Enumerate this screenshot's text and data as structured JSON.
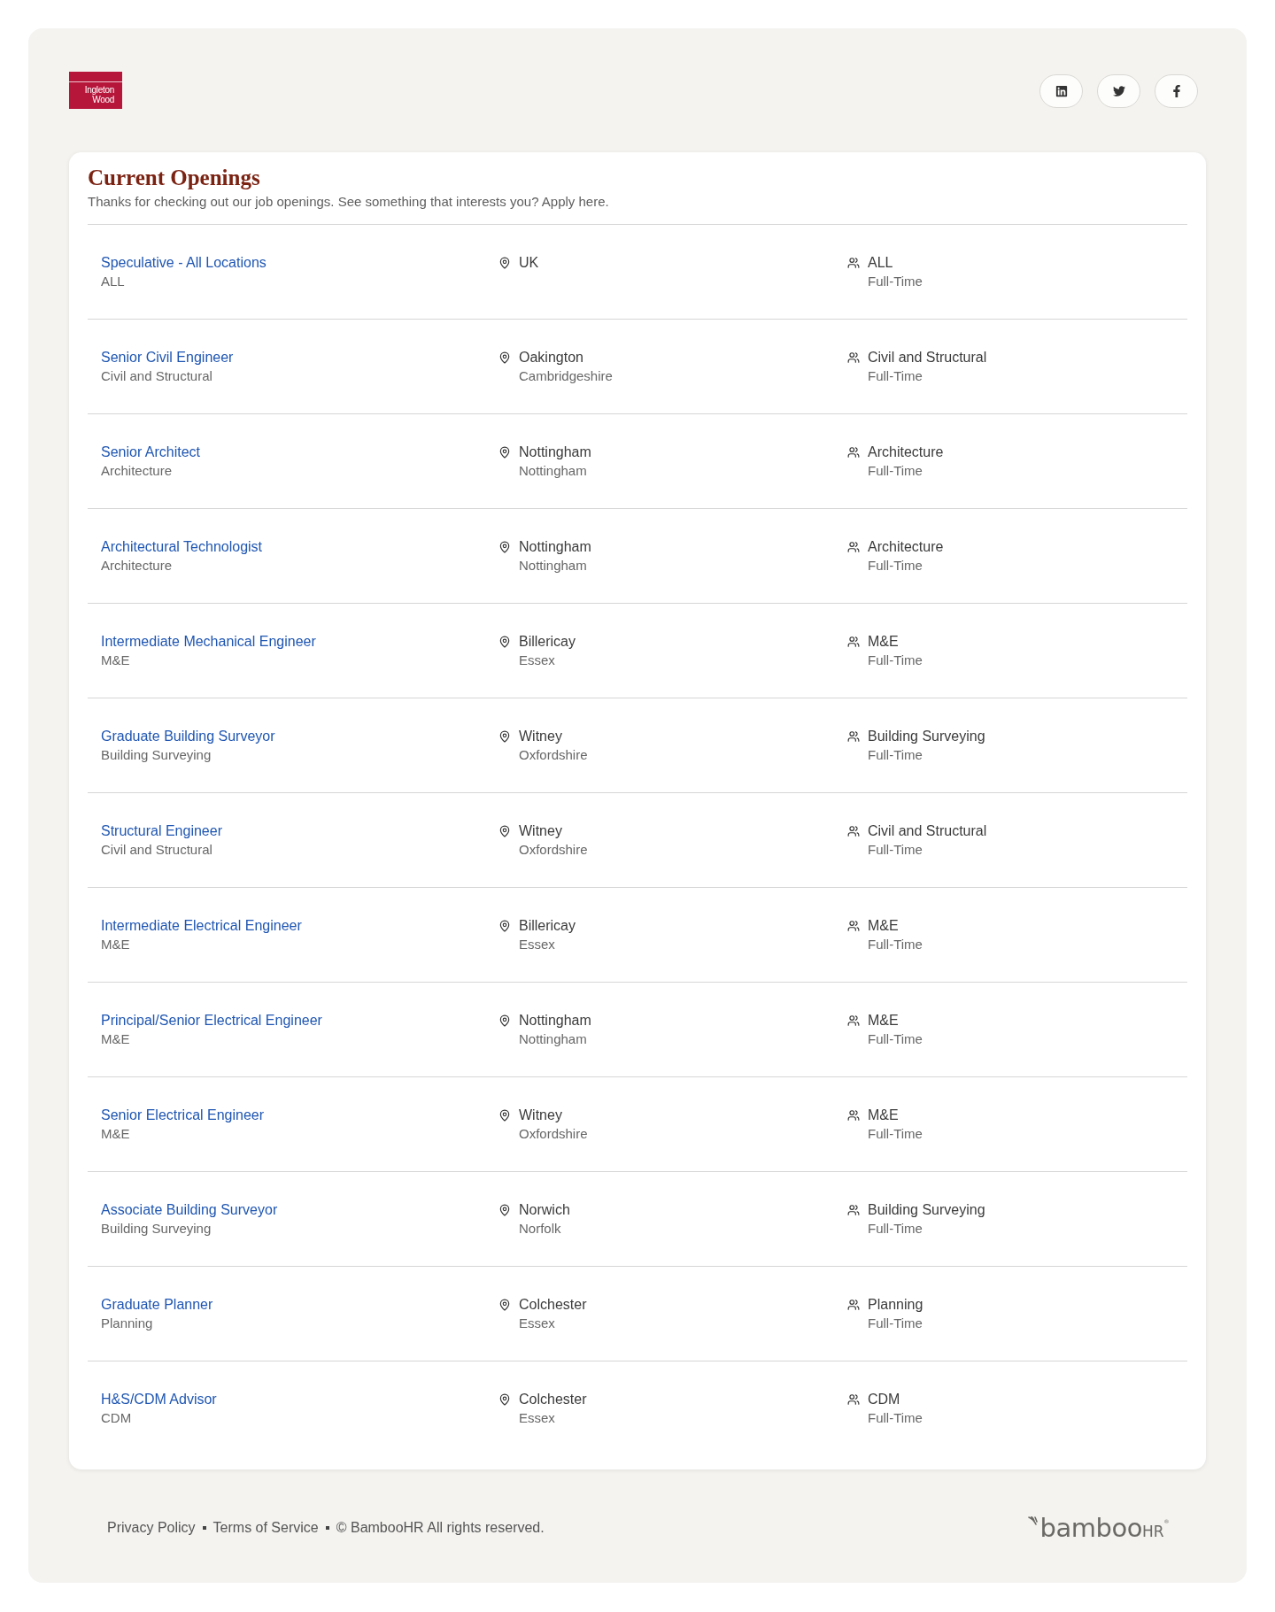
{
  "header": {
    "logo": {
      "lines": [
        "Ingleton",
        "Wood"
      ]
    },
    "social_links": [
      {
        "kind": "linkedin"
      },
      {
        "kind": "twitter"
      },
      {
        "kind": "facebook"
      }
    ]
  },
  "openings": {
    "title": "Current Openings",
    "subtitle": "Thanks for checking out our job openings. See something that interests you? Apply here.",
    "jobs": [
      {
        "title": "Speculative - All Locations",
        "department": "ALL",
        "city": "UK",
        "category": "ALL",
        "employment_type": "Full-Time"
      },
      {
        "title": "Senior Civil Engineer",
        "department": "Civil and Structural",
        "city": "Oakington",
        "region": "Cambridgeshire",
        "category": "Civil and Structural",
        "employment_type": "Full-Time"
      },
      {
        "title": "Senior Architect",
        "department": "Architecture",
        "city": "Nottingham",
        "region": "Nottingham",
        "category": "Architecture",
        "employment_type": "Full-Time"
      },
      {
        "title": "Architectural Technologist",
        "department": "Architecture",
        "city": "Nottingham",
        "region": "Nottingham",
        "category": "Architecture",
        "employment_type": "Full-Time"
      },
      {
        "title": "Intermediate Mechanical Engineer",
        "department": "M&E",
        "city": "Billericay",
        "region": "Essex",
        "category": "M&E",
        "employment_type": "Full-Time"
      },
      {
        "title": "Graduate Building Surveyor",
        "department": "Building Surveying",
        "city": "Witney",
        "region": "Oxfordshire",
        "category": "Building Surveying",
        "employment_type": "Full-Time"
      },
      {
        "title": "Structural Engineer",
        "department": "Civil and Structural",
        "city": "Witney",
        "region": "Oxfordshire",
        "category": "Civil and Structural",
        "employment_type": "Full-Time"
      },
      {
        "title": "Intermediate Electrical Engineer",
        "department": "M&E",
        "city": "Billericay",
        "region": "Essex",
        "category": "M&E",
        "employment_type": "Full-Time"
      },
      {
        "title": "Principal/Senior Electrical Engineer",
        "department": "M&E",
        "city": "Nottingham",
        "region": "Nottingham",
        "category": "M&E",
        "employment_type": "Full-Time"
      },
      {
        "title": "Senior Electrical Engineer",
        "department": "M&E",
        "city": "Witney",
        "region": "Oxfordshire",
        "category": "M&E",
        "employment_type": "Full-Time"
      },
      {
        "title": "Associate Building Surveyor",
        "department": "Building Surveying",
        "city": "Norwich",
        "region": "Norfolk",
        "category": "Building Surveying",
        "employment_type": "Full-Time"
      },
      {
        "title": "Graduate Planner",
        "department": "Planning",
        "city": "Colchester",
        "region": "Essex",
        "category": "Planning",
        "employment_type": "Full-Time"
      },
      {
        "title": "H&S/CDM Advisor",
        "department": "CDM",
        "city": "Colchester",
        "region": "Essex",
        "category": "CDM",
        "employment_type": "Full-Time"
      }
    ]
  },
  "footer": {
    "links": [
      "Privacy Policy",
      "Terms of Service"
    ],
    "copyright": "© BambooHR All rights reserved.",
    "brand": {
      "name": "bamboo",
      "suffix": "HR",
      "mark": "®"
    }
  }
}
